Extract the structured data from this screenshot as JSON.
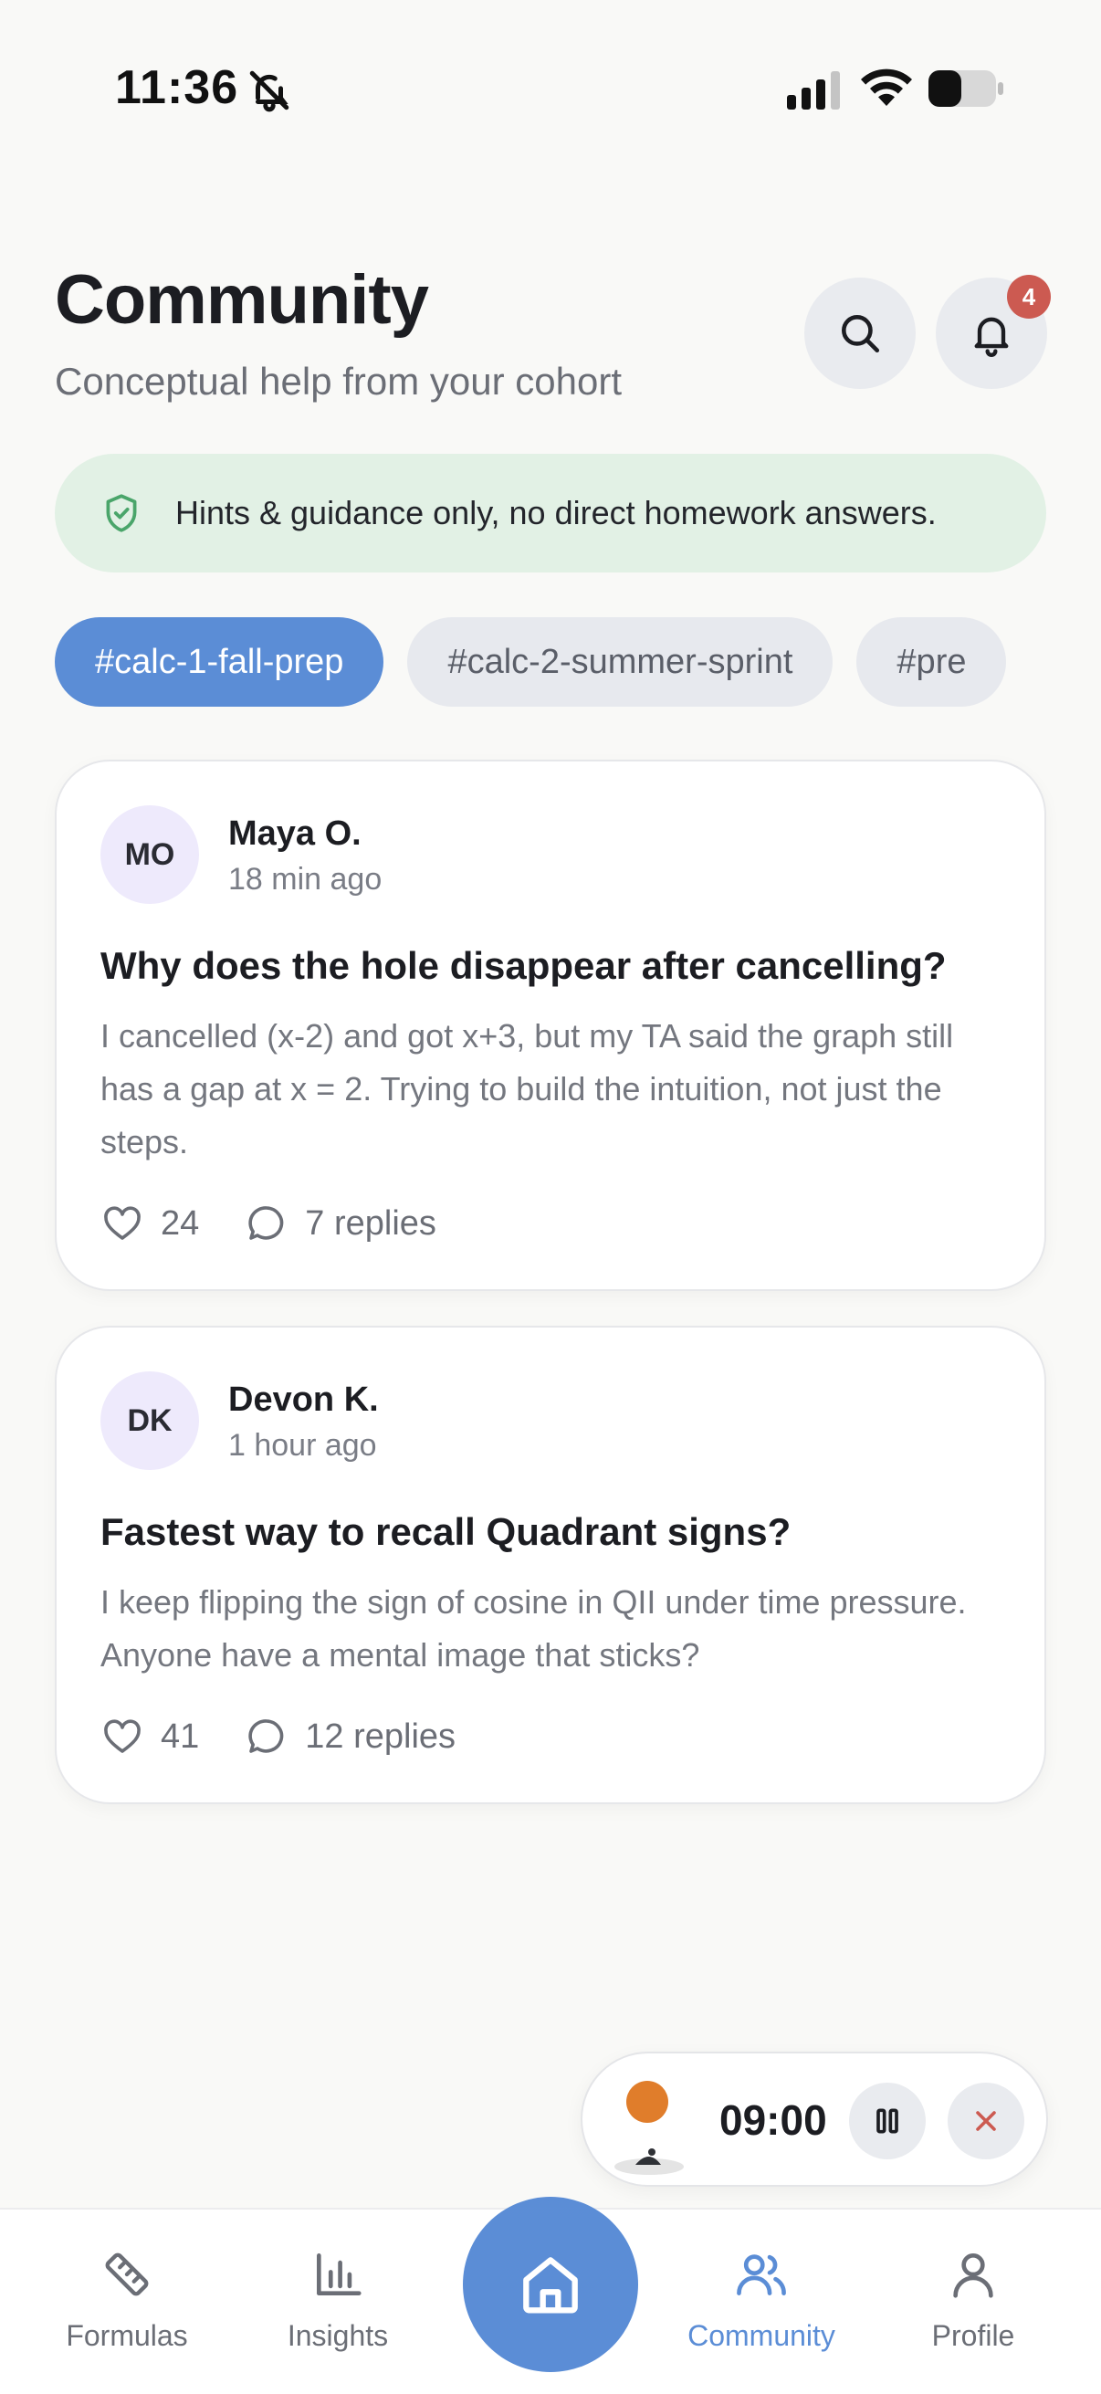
{
  "status_bar": {
    "time": "11:36"
  },
  "header": {
    "title": "Community",
    "subtitle": "Conceptual help from your cohort",
    "notification_count": "4"
  },
  "hint": {
    "text": "Hints & guidance only, no direct homework answers."
  },
  "chips": [
    "#calc-1-fall-prep",
    "#calc-2-summer-sprint",
    "#pre"
  ],
  "posts": [
    {
      "initials": "MO",
      "author": "Maya O.",
      "time": "18 min ago",
      "title": "Why does the hole disappear after cancelling?",
      "body": "I cancelled (x-2) and got x+3, but my TA said the graph still has a gap at x = 2. Trying to build the intuition, not just the steps.",
      "likes": "24",
      "replies": "7 replies"
    },
    {
      "initials": "DK",
      "author": "Devon K.",
      "time": "1 hour ago",
      "title": "Fastest way to recall Quadrant signs?",
      "body": "I keep flipping the sign of cosine in QII under time pressure. Anyone have a mental image that sticks?",
      "likes": "41",
      "replies": "12 replies"
    }
  ],
  "timer": {
    "time": "09:00"
  },
  "nav": {
    "formulas": "Formulas",
    "insights": "Insights",
    "community": "Community",
    "profile": "Profile"
  },
  "colors": {
    "accent": "#5b8dd6",
    "badge": "#cc5a51",
    "hint_bg": "#e2f1e5"
  }
}
